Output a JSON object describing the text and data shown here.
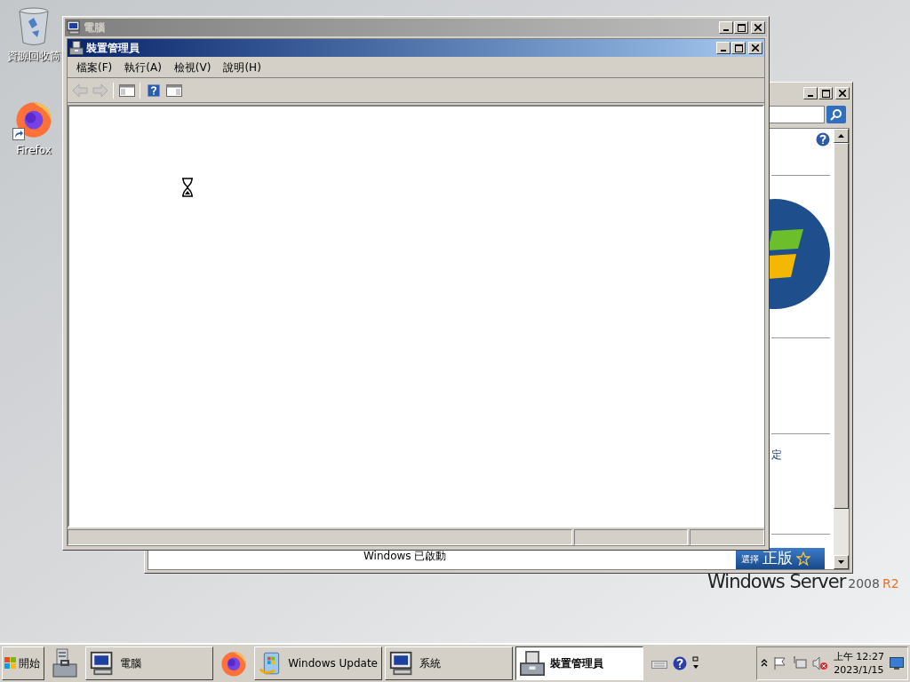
{
  "desktop_icons": [
    {
      "kind": "recycle_bin",
      "label": "資源回收筒"
    },
    {
      "kind": "firefox",
      "label": "Firefox"
    }
  ],
  "back_window": {
    "active": false,
    "fragment_text": "定",
    "status_text": "Windows 已啟動",
    "genuine_button": {
      "label_small": "選擇",
      "label_large": "正版"
    }
  },
  "front_window": {
    "title": "電腦",
    "active": false,
    "child_window": {
      "title": "裝置管理員",
      "active": true,
      "menu": [
        "檔案(F)",
        "執行(A)",
        "檢視(V)",
        "說明(H)"
      ],
      "toolbar": [
        {
          "kind": "back",
          "disabled": true
        },
        {
          "kind": "forward",
          "disabled": true
        },
        {
          "kind": "separator"
        },
        {
          "kind": "console_tree",
          "disabled": false
        },
        {
          "kind": "separator"
        },
        {
          "kind": "help",
          "disabled": false
        },
        {
          "kind": "action_pane",
          "disabled": false
        }
      ],
      "busy": true
    }
  },
  "os_logo": {
    "brand": "Windows Server",
    "version": "2008",
    "release": "R2"
  },
  "taskbar": {
    "start": "開始",
    "items": [
      {
        "kind": "server_launcher"
      },
      {
        "kind": "computer_task",
        "label": "電腦",
        "selected": false
      },
      {
        "kind": "browser_launcher"
      },
      {
        "kind": "update_task",
        "label": "Windows Update",
        "selected": false
      },
      {
        "kind": "computer_task",
        "label": "系統",
        "selected": false
      },
      {
        "kind": "toolbox_task",
        "label": "裝置管理員",
        "selected": true
      }
    ],
    "clock": {
      "time": "上午 12:27",
      "date": "2023/1/15"
    }
  }
}
